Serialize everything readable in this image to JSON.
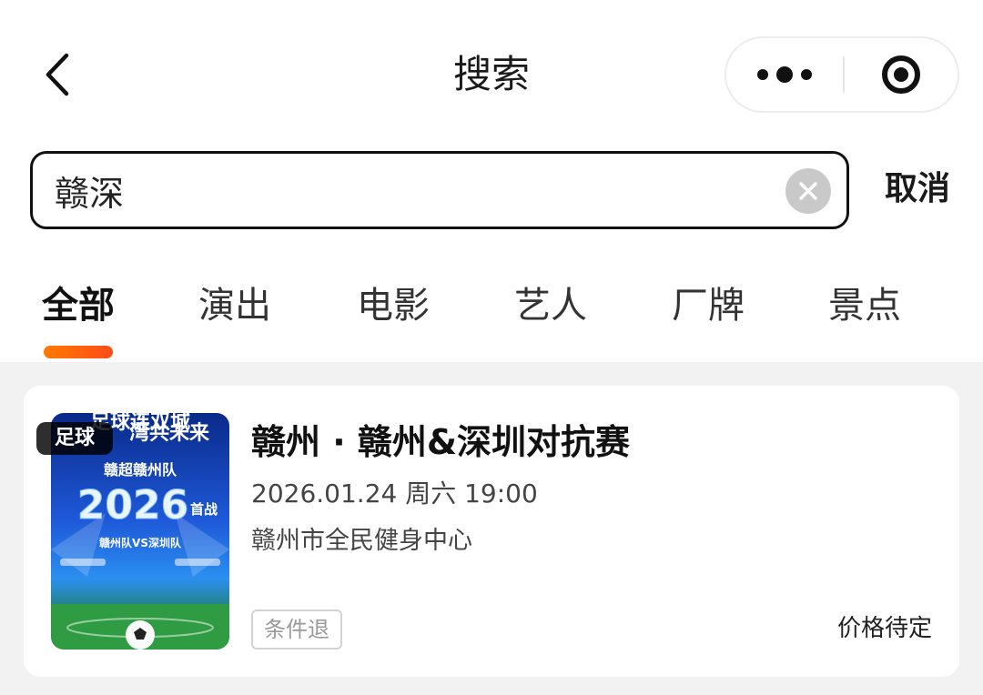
{
  "header": {
    "title": "搜索",
    "back_icon": "chevron-left-icon",
    "more_icon": "more-dots-icon",
    "close_icon": "target-circle-icon"
  },
  "search": {
    "value": "赣深",
    "placeholder": "",
    "clear_icon": "clear-x-icon",
    "cancel_label": "取消"
  },
  "tabs": [
    {
      "label": "全部",
      "active": true
    },
    {
      "label": "演出",
      "active": false
    },
    {
      "label": "电影",
      "active": false
    },
    {
      "label": "艺人",
      "active": false
    },
    {
      "label": "厂牌",
      "active": false
    },
    {
      "label": "景点",
      "active": false
    }
  ],
  "colors": {
    "accent": "#ff6a14",
    "page_bg": "#f2f2f2"
  },
  "results": [
    {
      "category_badge": "足球",
      "title": "赣州 · 赣州&深圳对抗赛",
      "datetime": "2026.01.24 周六 19:00",
      "venue": "赣州市全民健身中心",
      "refund_tag": "条件退",
      "price": "价格待定",
      "poster": {
        "line1": "足球连双城",
        "line2": "湾共未来",
        "team": "赣超赣州队",
        "year": "2026",
        "debut": "首战",
        "matchup": "赣州队VS深圳队"
      }
    }
  ]
}
